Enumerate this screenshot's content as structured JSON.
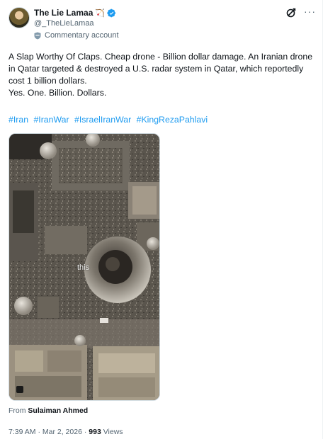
{
  "author": {
    "display_name": "The Lie Lamaa",
    "emoji": "🏹",
    "handle": "@_TheLieLamaa",
    "account_label": "Commentary account"
  },
  "tweet": {
    "text_lines": [
      "A Slap Worthy Of Claps. Cheap drone - Billion dollar damage. An Iranian drone in Qatar targeted & destroyed a U.S. radar system in Qatar, which reportedly cost 1 billion dollars.",
      "Yes. One. Billion. Dollars."
    ],
    "hashtags": [
      "#Iran",
      "#IranWar",
      "#IsraelIranWar",
      "#KingRezaPahlavi"
    ]
  },
  "media": {
    "overlay_caption": "this"
  },
  "attribution": {
    "prefix": "From",
    "source": "Sulaiman Ahmed"
  },
  "meta": {
    "time": "7:39 AM",
    "separator": "·",
    "date": "Mar 2, 2026",
    "views_count": "993",
    "views_label": "Views"
  },
  "icon_names": [
    "verified-badge-icon",
    "shield-icon",
    "grok-icon",
    "more-icon"
  ]
}
